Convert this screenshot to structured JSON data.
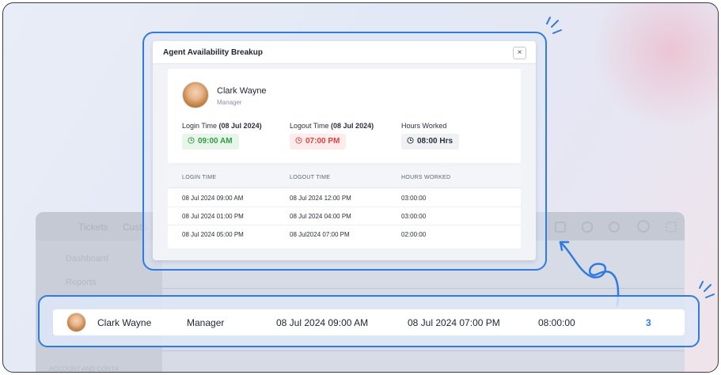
{
  "background_app": {
    "tabs": [
      "Tickets",
      "Custo"
    ],
    "sidebar_items": [
      "Dashboard",
      "Reports"
    ],
    "sidebar_footer": "ACCOUNT AND CONTA"
  },
  "modal": {
    "title": "Agent Availability Breakup",
    "close_icon": "×",
    "agent": {
      "name": "Clark Wayne",
      "role": "Manager"
    },
    "summary": {
      "login_label": "Login Time",
      "login_date": "(08 Jul 2024)",
      "login_value": "09:00 AM",
      "logout_label": "Logout Time",
      "logout_date": "(08 Jul 2024)",
      "logout_value": "07:00 PM",
      "hours_label": "Hours Worked",
      "hours_value": "08:00 Hrs"
    },
    "table": {
      "headers": [
        "LOGIN TIME",
        "LOGOUT TIME",
        "HOURS WORKED"
      ],
      "rows": [
        [
          "08 Jul 2024  09:00 AM",
          "08 Jul 2024  12:00 PM",
          "03:00:00"
        ],
        [
          "08 Jul 2024  01:00 PM",
          "08 Jul 2024  04:00 PM",
          "03:00:00"
        ],
        [
          "08 Jul 2024  05:00 PM",
          "08 Jul2024  07:00 PM",
          "02:00:00"
        ]
      ]
    }
  },
  "highlight_row": {
    "name": "Clark Wayne",
    "role": "Manager",
    "login": "08 Jul 2024 09:00 AM",
    "logout": "08 Jul 2024 07:00 PM",
    "hours": "08:00:00",
    "count": "3"
  },
  "colors": {
    "accent": "#2f7be0",
    "login_green": "#2e9e41",
    "logout_red": "#d9423d"
  }
}
